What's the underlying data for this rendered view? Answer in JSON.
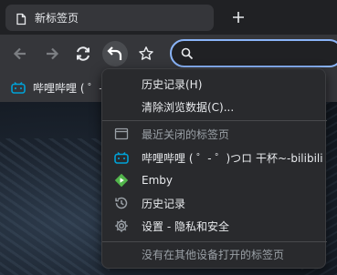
{
  "tab": {
    "title": "新标签页"
  },
  "bookmarks": {
    "items": [
      {
        "label": "哔哩哔哩 ( ゜- ゜)つロ"
      }
    ]
  },
  "menu": {
    "history": "历史记录(H)",
    "clear_data": "清除浏览数据(C)...",
    "recently_closed_header": "最近关闭的标签页",
    "recent_items": [
      {
        "label": "哔哩哔哩 ( ゜- ゜)つロ 干杯~-bilibili",
        "icon": "bilibili-icon"
      },
      {
        "label": "Emby",
        "icon": "emby-icon"
      },
      {
        "label": "历史记录",
        "icon": "history-icon"
      },
      {
        "label": "设置 - 隐私和安全",
        "icon": "settings-icon"
      }
    ],
    "other_devices": "没有在其他设备打开的标签页"
  },
  "colors": {
    "accent": "#8ab4f8",
    "bilibili": "#00a1d6",
    "emby": "#52b54b"
  }
}
